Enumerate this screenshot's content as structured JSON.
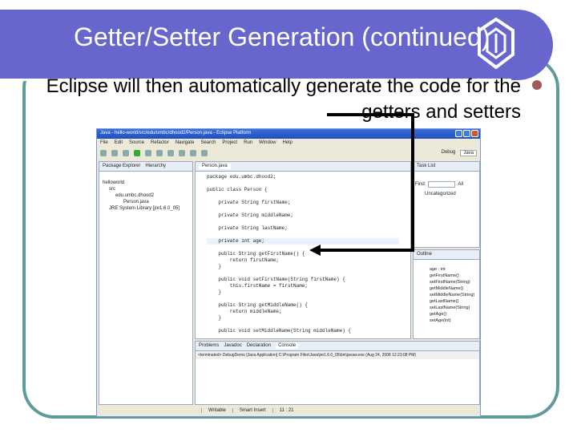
{
  "slide": {
    "title": "Getter/Setter Generation (continued)",
    "body": "Eclipse will then automatically generate the code for the getters and setters",
    "accent": "#6666cc",
    "border": "#5f9a9a"
  },
  "eclipse": {
    "window_title": "Java - hello-world/src/edu/umbc/dhood2/Person.java - Eclipse Platform",
    "menu": [
      "File",
      "Edit",
      "Source",
      "Refactor",
      "Navigate",
      "Search",
      "Project",
      "Run",
      "Window",
      "Help"
    ],
    "perspectives": [
      "Debug",
      "Java"
    ],
    "left_tabs": [
      "Package Explorer",
      "Hierarchy"
    ],
    "tree": [
      "helloworld",
      "src",
      "edu.umbc.dhood2",
      "Person.java",
      "JRE System Library [jre1.6.0_05]"
    ],
    "editor_tab": "Person.java",
    "code": [
      {
        "t": "package edu.umbc.dhood2;"
      },
      {
        "t": ""
      },
      {
        "t": "public class Person {"
      },
      {
        "t": ""
      },
      {
        "t": "    private String firstName;"
      },
      {
        "t": ""
      },
      {
        "t": "    private String middleName;"
      },
      {
        "t": ""
      },
      {
        "t": "    private String lastName;"
      },
      {
        "t": ""
      },
      {
        "t": "    private int age;"
      },
      {
        "t": ""
      },
      {
        "t": "    public String getFirstName() {"
      },
      {
        "t": "        return firstName;"
      },
      {
        "t": "    }"
      },
      {
        "t": ""
      },
      {
        "t": "    public void setFirstName(String firstName) {"
      },
      {
        "t": "        this.firstName = firstName;"
      },
      {
        "t": "    }"
      },
      {
        "t": ""
      },
      {
        "t": "    public String getMiddleName() {"
      },
      {
        "t": "        return middleName;"
      },
      {
        "t": "    }"
      },
      {
        "t": ""
      },
      {
        "t": "    public void setMiddleName(String middleName) {"
      }
    ],
    "task_tab": "Task List",
    "find_label": "Find:",
    "all_label": "All",
    "uncategorized": "Uncategorized",
    "outline_tab": "Outline",
    "outline": [
      "age : int",
      "getFirstName()",
      "setFirstName(String)",
      "getMiddleName()",
      "setMiddleName(String)",
      "getLastName()",
      "setLastName(String)",
      "getAge()",
      "setAge(int)"
    ],
    "bottom_tabs": [
      "Problems",
      "Javadoc",
      "Declaration",
      "Console"
    ],
    "console_line": "<terminated> DebugDemo [Java Application] C:\\Program Files\\Java\\jre1.6.0_05\\bin\\javaw.exe (Aug 24, 2008 12:23:08 PM)",
    "status": {
      "writable": "Writable",
      "insert": "Smart Insert",
      "position": "11 : 21"
    }
  }
}
